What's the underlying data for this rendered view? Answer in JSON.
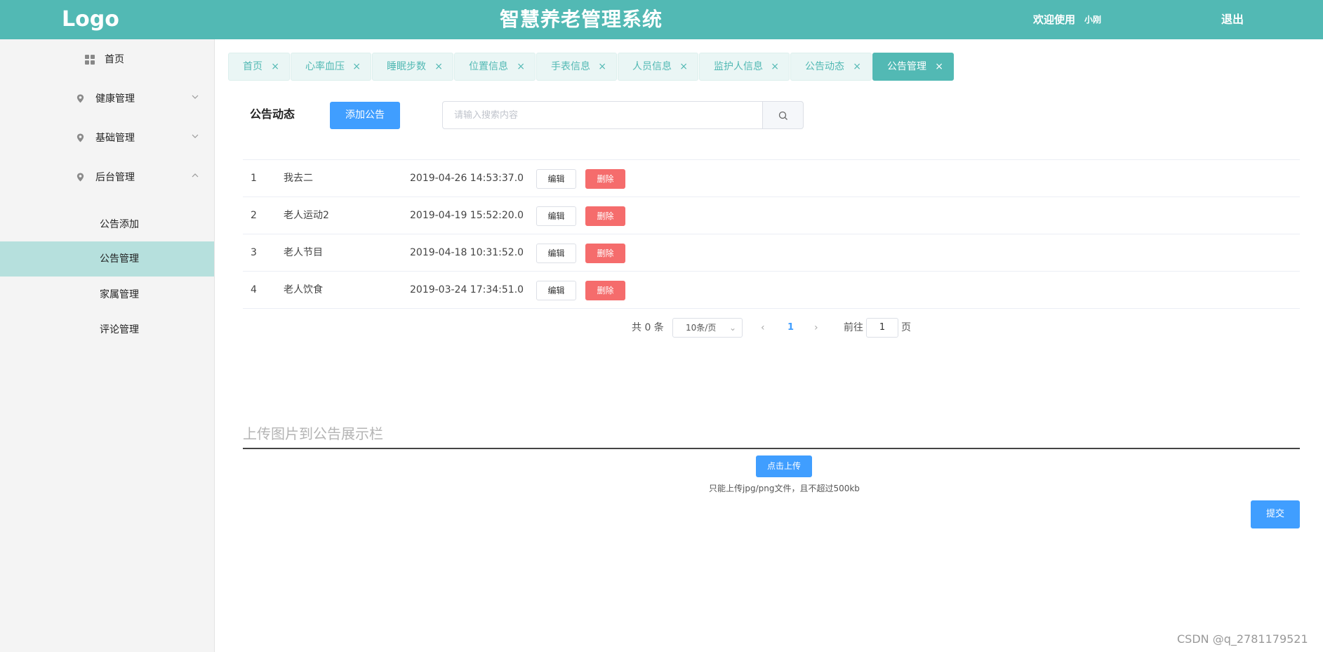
{
  "header": {
    "logo": "Logo",
    "title": "智慧养老管理系统",
    "welcome": "欢迎使用",
    "username": "小刚",
    "logout": "退出"
  },
  "sidebar": {
    "home": "首页",
    "groups": [
      {
        "label": "健康管理",
        "expanded": false
      },
      {
        "label": "基础管理",
        "expanded": false
      },
      {
        "label": "后台管理",
        "expanded": true
      }
    ],
    "subitems": [
      "公告添加",
      "公告管理",
      "家属管理",
      "评论管理"
    ],
    "active_subitem": "公告管理"
  },
  "tabs": [
    {
      "label": "首页",
      "active": false
    },
    {
      "label": "心率血压",
      "active": false
    },
    {
      "label": "睡眠步数",
      "active": false
    },
    {
      "label": "位置信息",
      "active": false
    },
    {
      "label": "手表信息",
      "active": false
    },
    {
      "label": "人员信息",
      "active": false
    },
    {
      "label": "监护人信息",
      "active": false
    },
    {
      "label": "公告动态",
      "active": false
    },
    {
      "label": "公告管理",
      "active": true
    }
  ],
  "tab_close_glyph": "×",
  "toolbar": {
    "section_title": "公告动态",
    "add_label": "添加公告",
    "search_placeholder": "请输入搜索内容",
    "search_value": ""
  },
  "table": {
    "edit_label": "编辑",
    "delete_label": "删除",
    "rows": [
      {
        "index": "1",
        "title": "我去二",
        "time": "2019-04-26 14:53:37.0"
      },
      {
        "index": "2",
        "title": "老人运动2",
        "time": "2019-04-19 15:52:20.0"
      },
      {
        "index": "3",
        "title": "老人节目",
        "time": "2019-04-18 10:31:52.0"
      },
      {
        "index": "4",
        "title": "老人饮食",
        "time": "2019-03-24 17:34:51.0"
      }
    ]
  },
  "pagination": {
    "total_text": "共 0 条",
    "page_size": "10条/页",
    "current_page": "1",
    "goto_label": "前往",
    "goto_value": "1",
    "page_suffix": "页"
  },
  "upload": {
    "title": "上传图片到公告展示栏",
    "button": "点击上传",
    "tip": "只能上传jpg/png文件，且不超过500kb",
    "submit": "提交"
  },
  "watermark": "CSDN @q_2781179521",
  "colors": {
    "brand": "#52b9b4",
    "primary": "#409eff",
    "danger": "#f56c6c",
    "active_menu_bg": "#b6e0dd"
  },
  "icons": {
    "home": "grid-icon",
    "group": "location-pin-icon",
    "search": "search-icon",
    "collapse": "chevron-up-icon",
    "expand": "chevron-down-icon"
  }
}
